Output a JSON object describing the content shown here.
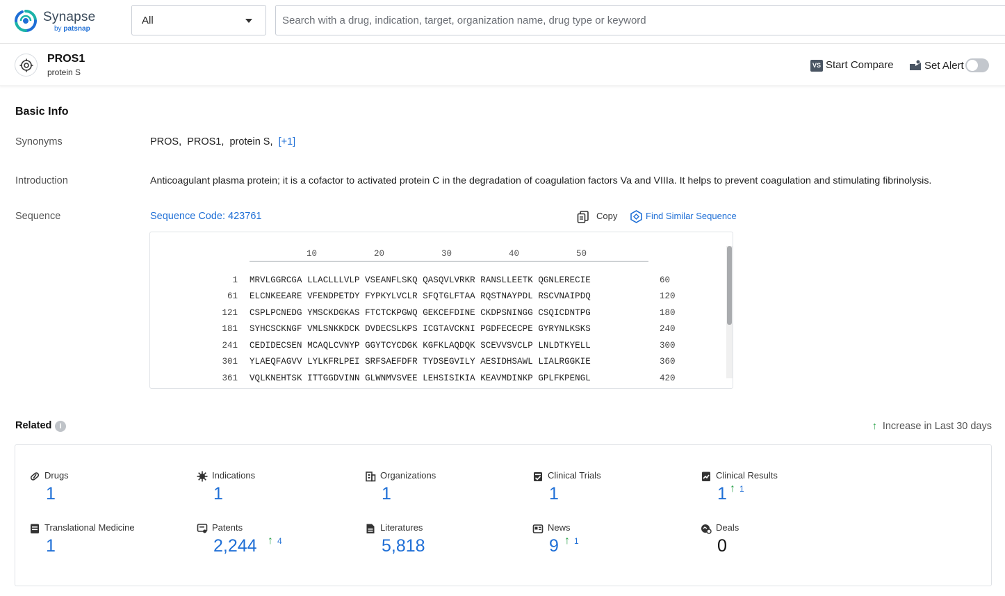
{
  "brand": {
    "name": "Synapse",
    "by": "by ",
    "by_strong": "patsnap"
  },
  "search": {
    "scope": "All",
    "placeholder": "Search with a drug, indication, target, organization name, drug type or keyword"
  },
  "entity": {
    "name": "PROS1",
    "subtitle": "protein S"
  },
  "actions": {
    "vs_badge": "VS",
    "compare_label": "Start Compare",
    "alert_label": "Set Alert",
    "alert_enabled": false
  },
  "basic_info": {
    "title": "Basic Info",
    "synonyms": {
      "label": "Synonyms",
      "values": [
        "PROS,",
        "PROS1,",
        "protein S,"
      ],
      "more": "[+1]"
    },
    "introduction": {
      "label": "Introduction",
      "text": "Anticoagulant plasma protein; it is a cofactor to activated protein C in the degradation of coagulation factors Va and VIIIa. It helps to prevent coagulation and stimulating fibrinolysis."
    },
    "sequence": {
      "label": "Sequence",
      "code_link": "Sequence Code: 423761",
      "copy_label": "Copy",
      "similar_label": "Find Similar Sequence",
      "ruler": [
        "10",
        "20",
        "30",
        "40",
        "50"
      ],
      "lines": [
        {
          "start": "1",
          "seq": "MRVLGGRCGA LLACLLLVLP VSEANFLSKQ QASQVLVRKR RANSLLEETK QGNLERECIE",
          "end": "60"
        },
        {
          "start": "61",
          "seq": "ELCNKEEARE VFENDPETDY FYPKYLVCLR SFQTGLFTAA RQSTNAYPDL RSCVNAIPDQ",
          "end": "120"
        },
        {
          "start": "121",
          "seq": "CSPLPCNEDG YMSCKDGKAS FTCTCKPGWQ GEKCEFDINE CKDPSNINGG CSQICDNTPG",
          "end": "180"
        },
        {
          "start": "181",
          "seq": "SYHCSCKNGF VMLSNKKDCK DVDECSLKPS ICGTAVCKNI PGDFECECPE GYRYNLKSKS",
          "end": "240"
        },
        {
          "start": "241",
          "seq": "CEDIDECSEN MCAQLCVNYP GGYTCYCDGK KGFKLAQDQK SCEVVSVCLP LNLDTKYELL",
          "end": "300"
        },
        {
          "start": "301",
          "seq": "YLAEQFAGVV LYLKFRLPEI SRFSAEFDFR TYDSEGVILY AESIDHSAWL LIALRGGKIE",
          "end": "360"
        },
        {
          "start": "361",
          "seq": "VQLKNEHTSK ITTGGDVINN GLWNMVSVEE LEHSISIKIA KEAVMDINKP GPLFKPENGL",
          "end": "420"
        }
      ]
    }
  },
  "related": {
    "title": "Related",
    "info": "i",
    "increase_legend": "Increase in Last 30 days",
    "stats": [
      {
        "key": "drugs",
        "label": "Drugs",
        "value": "1",
        "increase": ""
      },
      {
        "key": "indications",
        "label": "Indications",
        "value": "1",
        "increase": ""
      },
      {
        "key": "organizations",
        "label": "Organizations",
        "value": "1",
        "increase": ""
      },
      {
        "key": "clinical-trials",
        "label": "Clinical Trials",
        "value": "1",
        "increase": ""
      },
      {
        "key": "clinical-results",
        "label": "Clinical Results",
        "value": "1",
        "increase": "1"
      },
      {
        "key": "translational-medicine",
        "label": "Translational Medicine",
        "value": "1",
        "increase": ""
      },
      {
        "key": "patents",
        "label": "Patents",
        "value": "2,244",
        "increase": "4"
      },
      {
        "key": "literatures",
        "label": "Literatures",
        "value": "5,818",
        "increase": ""
      },
      {
        "key": "news",
        "label": "News",
        "value": "9",
        "increase": "1"
      },
      {
        "key": "deals",
        "label": "Deals",
        "value": "0",
        "increase": ""
      }
    ]
  },
  "colors": {
    "accent": "#1f6fd6",
    "increase": "#2ba24a",
    "logo_teal": "#1bb3a8",
    "logo_blue": "#1f6fd6"
  }
}
